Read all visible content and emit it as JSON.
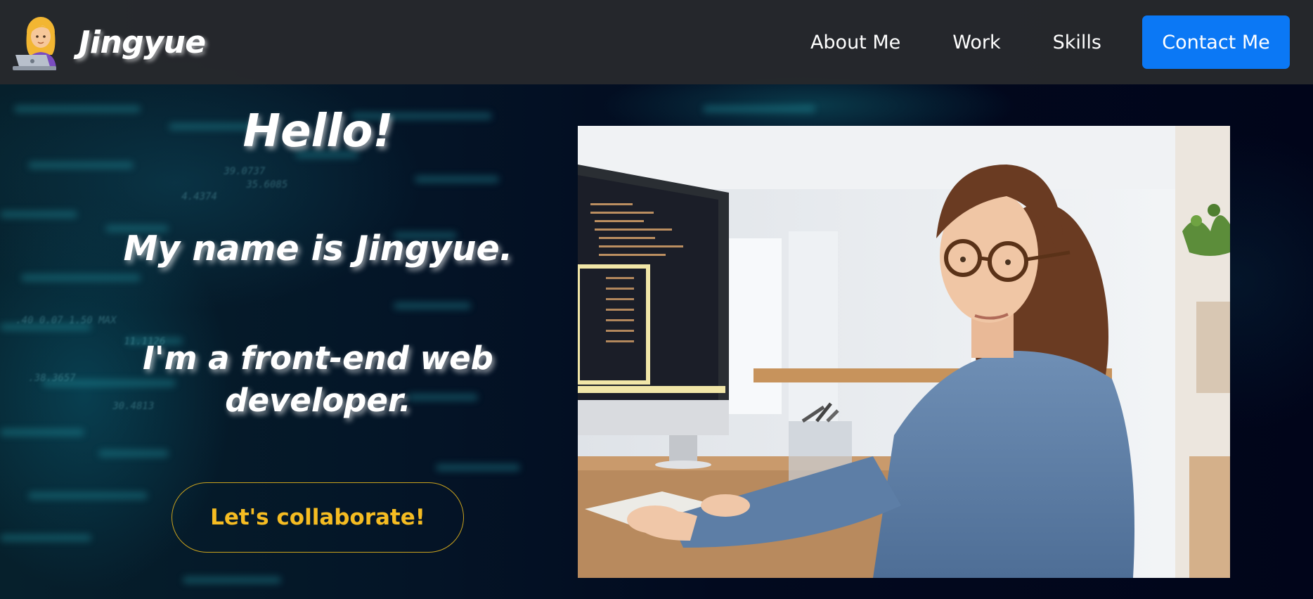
{
  "navbar": {
    "brand_icon": "woman-technologist-icon",
    "brand_name": "Jingyue",
    "links": [
      "About Me",
      "Work",
      "Skills"
    ],
    "contact_label": "Contact Me",
    "contact_color": "#0b78f5"
  },
  "hero": {
    "greeting": "Hello!",
    "name_line": "My name is Jingyue.",
    "role_line": "I'm a front-end web developer.",
    "cta_label": "Let's collaborate!",
    "cta_color": "#f5bc22",
    "photo": "woman-at-computer-photo"
  }
}
